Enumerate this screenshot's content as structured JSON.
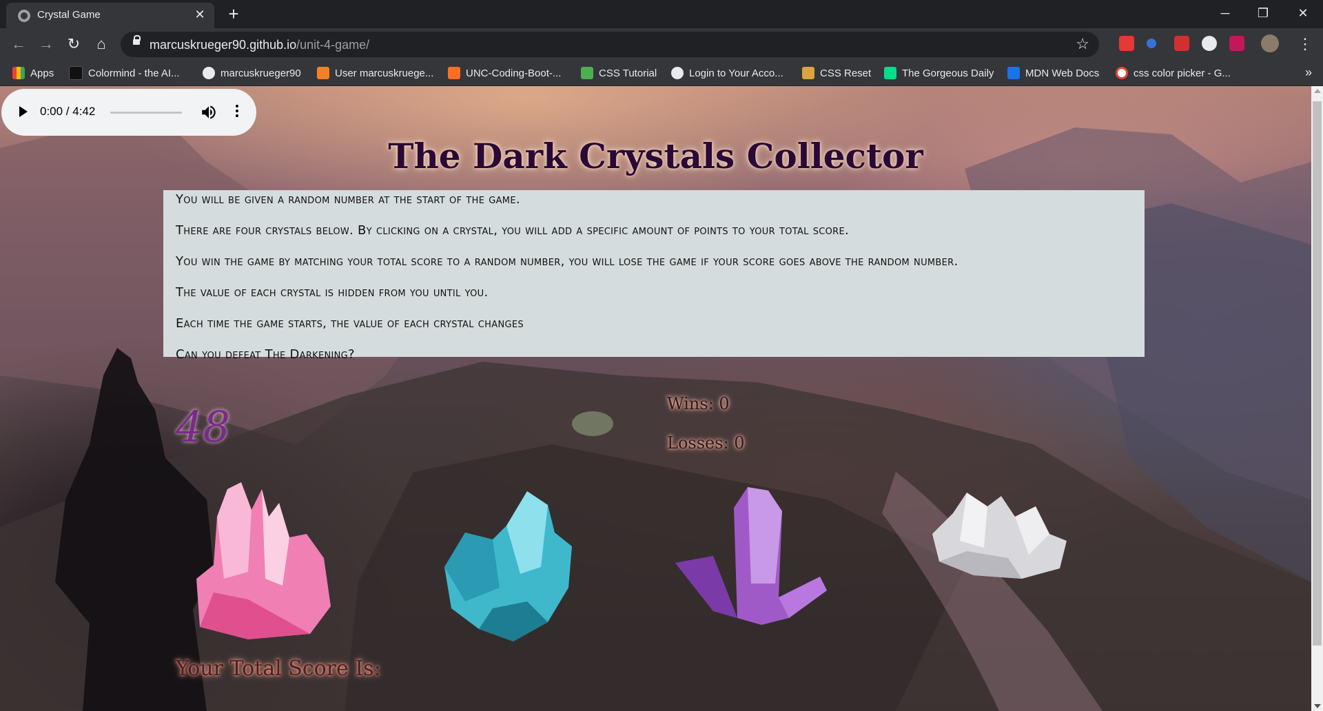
{
  "browser": {
    "tab_title": "Crystal Game",
    "tab_close": "✕",
    "new_tab": "+",
    "url_host": "marcuskrueger90.github.io",
    "url_path": "/unit-4-game/",
    "win_min": "─",
    "win_restore": "❐",
    "win_close": "✕",
    "bookmarks": [
      {
        "label": "Apps",
        "color": "#4285f4"
      },
      {
        "label": "Colormind - the AI...",
        "color": "#111111"
      },
      {
        "label": "marcuskrueger90",
        "color": "#e8eaed"
      },
      {
        "label": "User marcuskruege...",
        "color": "#f48024"
      },
      {
        "label": "UNC-Coding-Boot-...",
        "color": "#fc6d26"
      },
      {
        "label": "CSS Tutorial",
        "color": "#4caf50"
      },
      {
        "label": "Login to Your Acco...",
        "color": "#e8eaed"
      },
      {
        "label": "CSS Reset",
        "color": "#d9a441"
      },
      {
        "label": "The Gorgeous Daily",
        "color": "#00e08a"
      },
      {
        "label": "MDN Web Docs",
        "color": "#1a73e8"
      },
      {
        "label": "css color picker - G...",
        "color": "#ea4335"
      }
    ],
    "bookmarks_more": "»"
  },
  "audio": {
    "time": "0:00 / 4:42"
  },
  "page": {
    "title": "The Dark Crystals Collector",
    "rules": [
      "You will be given a random number at the start of the game.",
      "There are four crystals below. By clicking on a crystal, you will add a specific amount of points to your total score.",
      "You win the game by matching your total score to a random number, you will lose the game if your score goes above the random number.",
      "The value of each crystal is hidden from you until you.",
      "Each time the game starts, the value of each crystal changes",
      "Can you defeat The Darkening?"
    ],
    "target_number": "48",
    "wins": "Wins: 0",
    "losses": "Losses: 0",
    "score_label": "Your Total Score Is:",
    "crystals": [
      {
        "name": "pink-crystal",
        "color": "#f07fb4"
      },
      {
        "name": "blue-crystal",
        "color": "#3fb8cc"
      },
      {
        "name": "purple-crystal",
        "color": "#a05ac8"
      },
      {
        "name": "white-crystal",
        "color": "#d8d8dc"
      }
    ]
  }
}
